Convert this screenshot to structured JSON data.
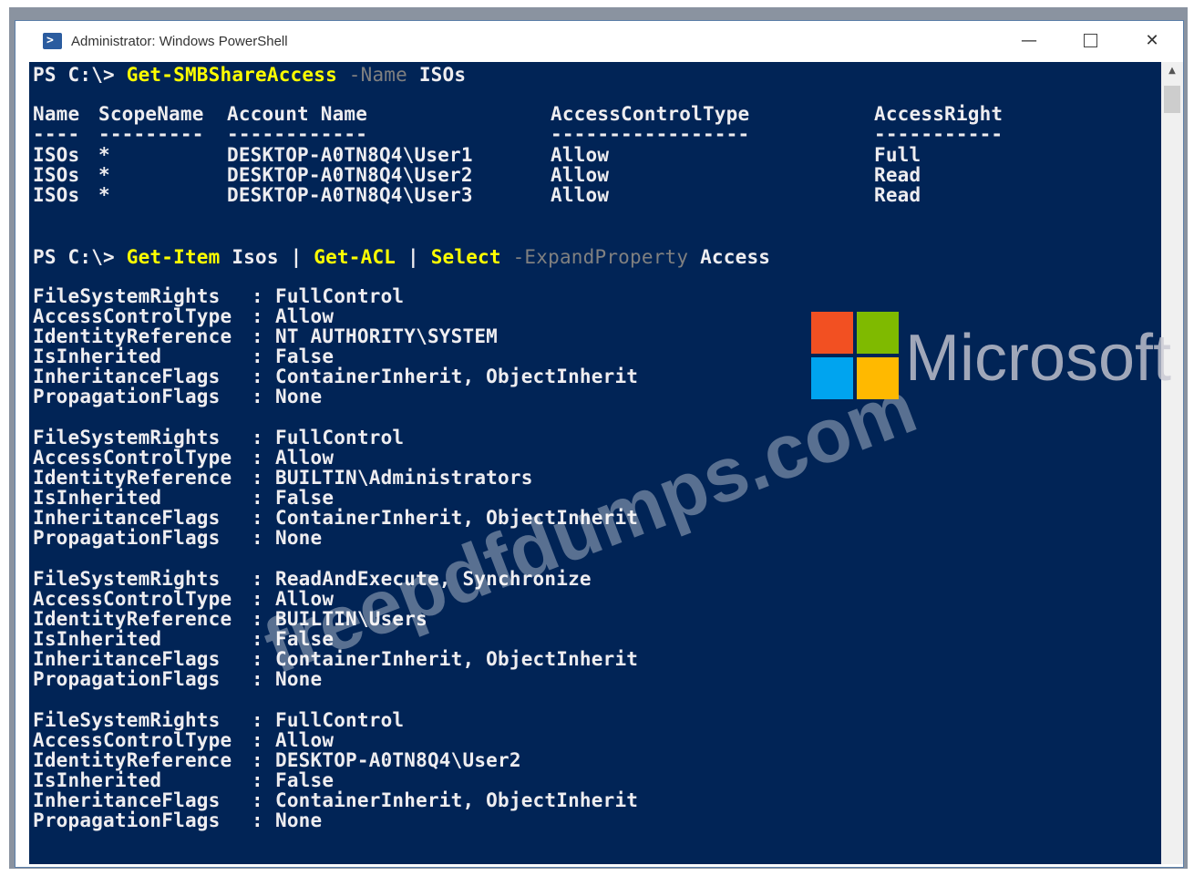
{
  "window": {
    "title": "Administrator: Windows PowerShell",
    "minimize_glyph": "—",
    "close_glyph": "✕",
    "scroll_up_glyph": "▲"
  },
  "prompt": "PS C:\\> ",
  "cmd1": {
    "cmdlet": "Get-SMBShareAccess",
    "param": "-Name",
    "arg": "ISOs"
  },
  "share_table": {
    "headers": [
      "Name",
      "ScopeName",
      "Account Name",
      "AccessControlType",
      "AccessRight"
    ],
    "separators": [
      "----",
      "---------",
      "------------",
      "-----------------",
      "-----------"
    ],
    "rows": [
      [
        "ISOs",
        "*",
        "DESKTOP-A0TN8Q4\\User1",
        "Allow",
        "Full"
      ],
      [
        "ISOs",
        "*",
        "DESKTOP-A0TN8Q4\\User2",
        "Allow",
        "Read"
      ],
      [
        "ISOs",
        "*",
        "DESKTOP-A0TN8Q4\\User3",
        "Allow",
        "Read"
      ]
    ]
  },
  "cmd2": {
    "cmdlet1": "Get-Item",
    "arg1": "Isos",
    "pipe1": "|",
    "cmdlet2": "Get-ACL",
    "pipe2": "|",
    "cmdlet3": "Select",
    "param": "-ExpandProperty",
    "arg2": "Access"
  },
  "acl_labels": [
    "FileSystemRights",
    "AccessControlType",
    "IdentityReference",
    "IsInherited",
    "InheritanceFlags",
    "PropagationFlags"
  ],
  "acl_entries": [
    [
      "FullControl",
      "Allow",
      "NT AUTHORITY\\SYSTEM",
      "False",
      "ContainerInherit, ObjectInherit",
      "None"
    ],
    [
      "FullControl",
      "Allow",
      "BUILTIN\\Administrators",
      "False",
      "ContainerInherit, ObjectInherit",
      "None"
    ],
    [
      "ReadAndExecute, Synchronize",
      "Allow",
      "BUILTIN\\Users",
      "False",
      "ContainerInherit, ObjectInherit",
      "None"
    ],
    [
      "FullControl",
      "Allow",
      "DESKTOP-A0TN8Q4\\User2",
      "False",
      "ContainerInherit, ObjectInherit",
      "None"
    ]
  ],
  "watermark": {
    "text": "freepdfdumps.com",
    "brand": "Microsoft"
  },
  "colors": {
    "console_bg": "#012456",
    "cmdlet": "#ffff00",
    "param": "#808080",
    "text": "#eeedf0"
  }
}
